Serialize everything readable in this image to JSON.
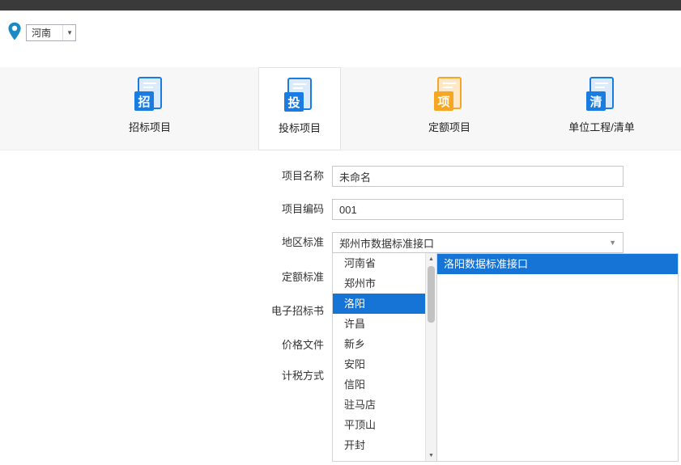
{
  "location": {
    "selected": "河南"
  },
  "tabs": [
    {
      "label": "招标项目",
      "char": "招",
      "selected": false
    },
    {
      "label": "投标项目",
      "char": "投",
      "selected": true
    },
    {
      "label": "定额项目",
      "char": "项",
      "selected": false
    },
    {
      "label": "单位工程/清单",
      "char": "清",
      "selected": false
    }
  ],
  "form": {
    "fields": [
      {
        "label": "项目名称",
        "value": "未命名"
      },
      {
        "label": "项目编码",
        "value": "001"
      },
      {
        "label": "地区标准",
        "value": "郑州市数据标准接口"
      },
      {
        "label": "定额标准"
      },
      {
        "label": "电子招标书"
      },
      {
        "label": "价格文件"
      },
      {
        "label": "计税方式"
      }
    ]
  },
  "region_dropdown": {
    "regions": [
      "河南省",
      "郑州市",
      "洛阳",
      "许昌",
      "新乡",
      "安阳",
      "信阳",
      "驻马店",
      "平顶山",
      "开封"
    ],
    "selected_region": "洛阳",
    "interfaces": [
      "洛阳数据标准接口"
    ],
    "selected_interface": "洛阳数据标准接口"
  },
  "colors": {
    "accent_blue": "#1a7ce0",
    "accent_orange": "#f5a623",
    "selection_blue": "#1674d6",
    "titlebar": "#3a3a3a"
  }
}
